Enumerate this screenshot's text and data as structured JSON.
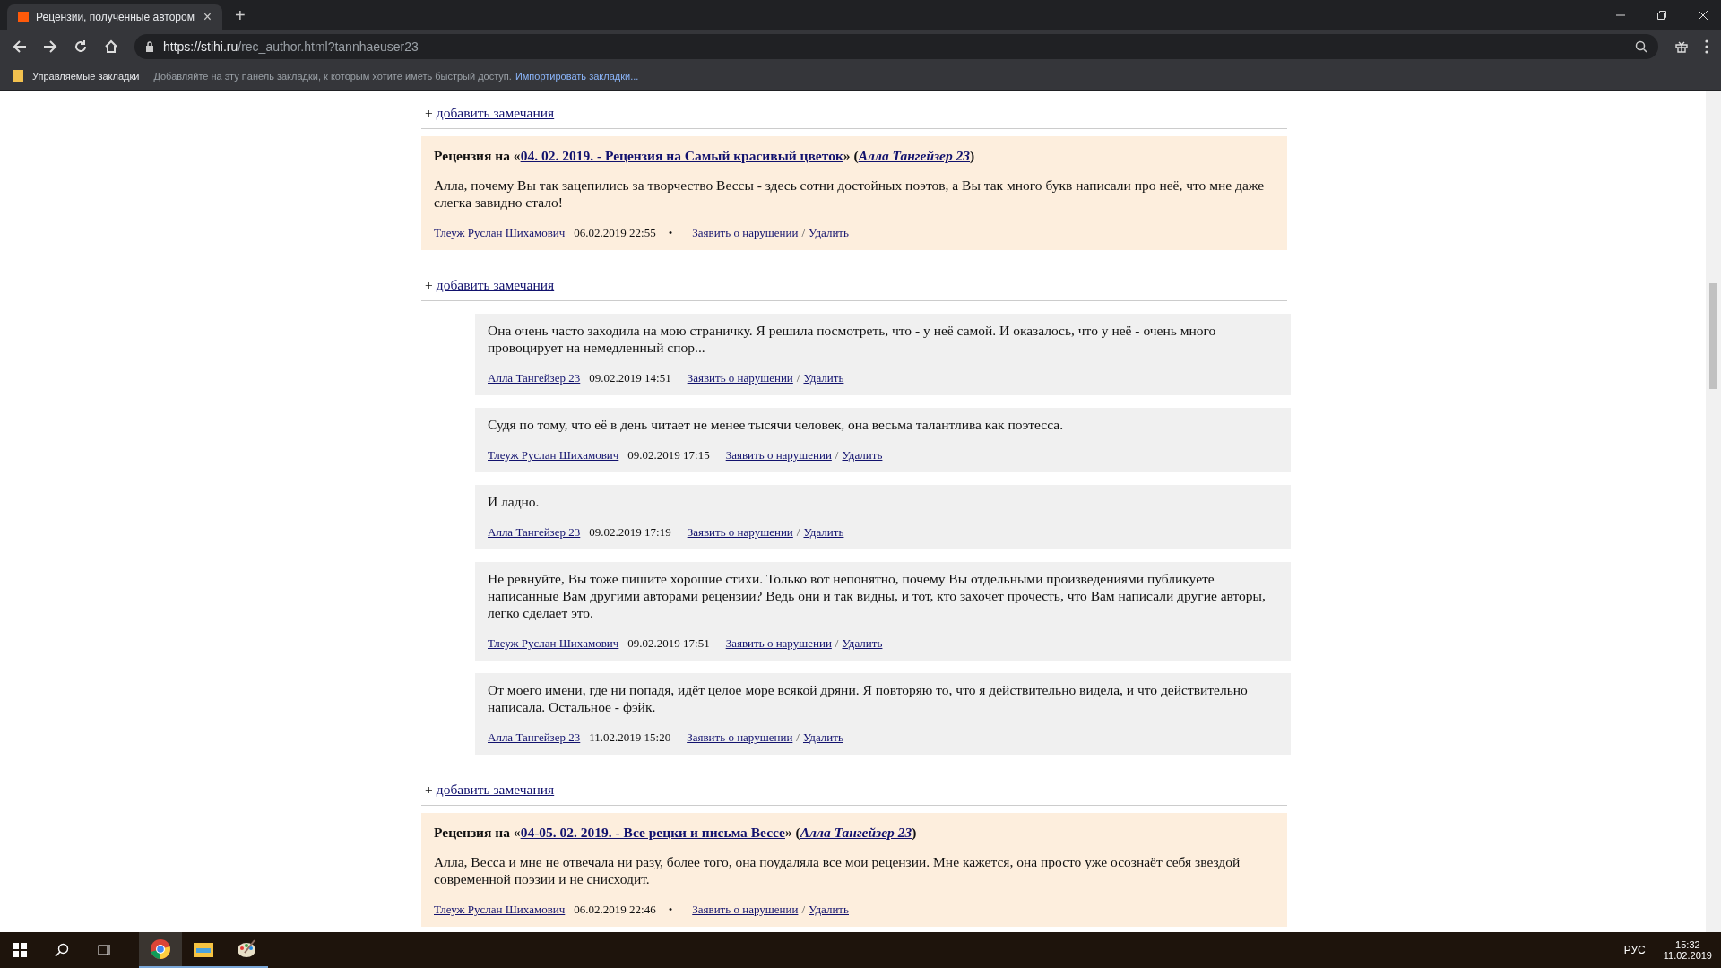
{
  "browser": {
    "tab": {
      "title": "Рецензии, полученные автором",
      "close": "×"
    },
    "new_tab": "+",
    "url": {
      "scheme": "https://",
      "host": "stihi.ru",
      "path": "/rec_author.html?tannhaeuser23"
    },
    "bookmarks": {
      "folder": "Управляемые закладки",
      "hint": "Добавляйте на эту панель закладки, к которым хотите иметь быстрый доступ.",
      "import": "Импортировать закладки..."
    }
  },
  "items": [
    {
      "kind": "add",
      "plus": "+",
      "label": "добавить замечания"
    },
    {
      "kind": "review",
      "prefix": "Рецензия на «",
      "work": "04. 02. 2019. - Рецензия на Самый красивый цветок",
      "mid": "» (",
      "work_author": "Алла Тангейзер 23",
      "suffix": ")",
      "text": "Алла, почему Вы так зацепились за творчество Вессы - здесь сотни достойных поэтов, а Вы так много букв написали про неё, что мне даже слегка завидно стало!",
      "author": "Тлеуж Руслан Шихамович",
      "date": "06.02.2019 22:55",
      "dot": "•",
      "report": "Заявить о нарушении",
      "slash": "/",
      "delete": "Удалить"
    },
    {
      "kind": "add",
      "plus": "+",
      "label": "добавить замечания"
    },
    {
      "kind": "reply",
      "text": "Она очень часто заходила на мою страничку. Я решила посмотреть, что - у неё самой. И оказалось, что у неё - очень много провоцирует на немедленный спор...",
      "author": "Алла Тангейзер 23",
      "date": "09.02.2019 14:51",
      "report": "Заявить о нарушении",
      "slash": "/",
      "delete": "Удалить"
    },
    {
      "kind": "reply",
      "text": "Судя по тому, что её в день читает не менее тысячи человек, она весьма талантлива как поэтесса.",
      "author": "Тлеуж Руслан Шихамович",
      "date": "09.02.2019 17:15",
      "report": "Заявить о нарушении",
      "slash": "/",
      "delete": "Удалить"
    },
    {
      "kind": "reply",
      "text": "И ладно.",
      "author": "Алла Тангейзер 23",
      "date": "09.02.2019 17:19",
      "report": "Заявить о нарушении",
      "slash": "/",
      "delete": "Удалить"
    },
    {
      "kind": "reply",
      "text": "Не ревнуйте, Вы тоже пишите хорошие стихи. Только вот непонятно, почему Вы отдельными произведениями публикуете написанные Вам другими авторами рецензии? Ведь они и так видны, и тот, кто захочет прочесть, что Вам написали другие авторы, легко сделает это.",
      "author": "Тлеуж Руслан Шихамович",
      "date": "09.02.2019 17:51",
      "report": "Заявить о нарушении",
      "slash": "/",
      "delete": "Удалить"
    },
    {
      "kind": "reply",
      "text": "От моего имени, где ни попадя, идёт целое море всякой дряни. Я повторяю то, что я действительно видела, и что действительно написала. Остальное - фэйк.",
      "author": "Алла Тангейзер 23",
      "date": "11.02.2019 15:20",
      "report": "Заявить о нарушении",
      "slash": "/",
      "delete": "Удалить"
    },
    {
      "kind": "add",
      "plus": "+",
      "label": "добавить замечания"
    },
    {
      "kind": "review",
      "prefix": "Рецензия на «",
      "work": "04-05. 02. 2019. - Все рецки и письма Вессе",
      "mid": "» (",
      "work_author": "Алла Тангейзер 23",
      "suffix": ")",
      "text": "Алла, Весса и мне не отвечала ни разу, более того, она поудаляла все мои рецензии. Мне кажется, она просто уже осознаёт себя звездой современной поэзии и не снисходит.",
      "author": "Тлеуж Руслан Шихамович",
      "date": "06.02.2019 22:46",
      "dot": "•",
      "report": "Заявить о нарушении",
      "slash": "/",
      "delete": "Удалить"
    }
  ],
  "taskbar": {
    "language": "РУС",
    "time": "15:32",
    "date": "11.02.2019"
  }
}
